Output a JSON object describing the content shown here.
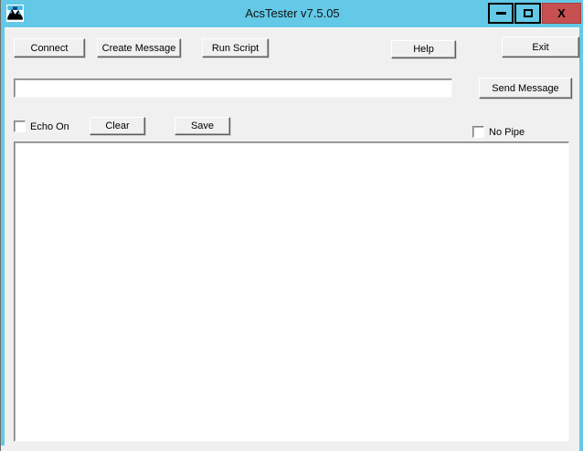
{
  "window": {
    "title": "AcsTester v7.5.05",
    "close_glyph": "X"
  },
  "colors": {
    "titlebar_blue": "#63C9E6",
    "close_red": "#C75050",
    "client_gray": "#F0F0F0"
  },
  "buttons": {
    "connect": "Connect",
    "create_message": "Create Message",
    "run_script": "Run Script",
    "help": "Help",
    "exit": "Exit",
    "send_message": "Send Message",
    "clear": "Clear",
    "save": "Save"
  },
  "message_bar": {
    "input_value": ""
  },
  "checkboxes": {
    "echo_on": {
      "label": "Echo On",
      "checked": false
    },
    "no_pipe": {
      "label": "No Pipe",
      "checked": false
    }
  },
  "log_area": {
    "content": ""
  }
}
